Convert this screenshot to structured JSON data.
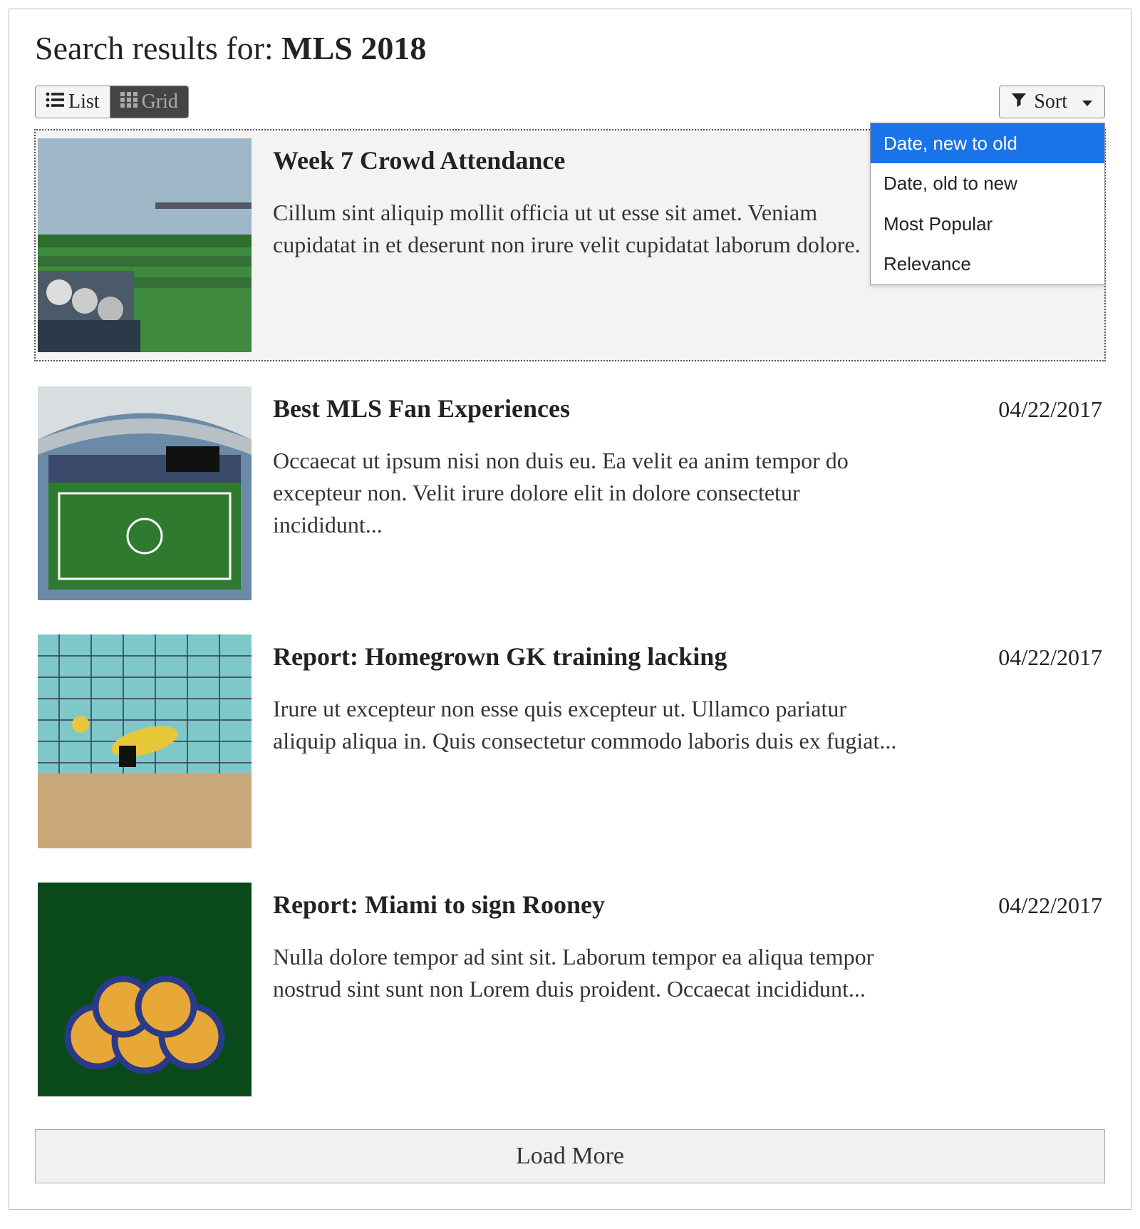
{
  "heading_prefix": "Search results for: ",
  "query": "MLS 2018",
  "view_toggle": {
    "list_label": "List",
    "grid_label": "Grid",
    "active": "list"
  },
  "sort": {
    "button_label": "Sort",
    "menu_open": true,
    "options": [
      {
        "label": "Date, new to old",
        "selected": true
      },
      {
        "label": "Date, old to new",
        "selected": false
      },
      {
        "label": "Most Popular",
        "selected": false
      },
      {
        "label": "Relevance",
        "selected": false
      }
    ]
  },
  "results": [
    {
      "title": "Week 7 Crowd Attendance",
      "date": "",
      "excerpt": "Cillum sint aliquip mollit officia ut ut esse sit amet. Veniam cupidatat in et deserunt non irure velit cupidatat laborum dolore.",
      "thumb": "spectators-pitch",
      "hovered": true
    },
    {
      "title": "Best MLS Fan Experiences",
      "date": "04/22/2017",
      "excerpt": "Occaecat ut ipsum nisi non duis eu. Ea velit ea anim tempor do excepteur non. Velit irure dolore elit in dolore consectetur incididunt...",
      "thumb": "stadium-wide",
      "hovered": false
    },
    {
      "title": "Report: Homegrown GK training lacking",
      "date": "04/22/2017",
      "excerpt": "Irure ut excepteur non esse quis excepteur ut. Ullamco pariatur aliquip aliqua in. Quis consectetur commodo laboris duis ex fugiat...",
      "thumb": "keeper-dive",
      "hovered": false
    },
    {
      "title": "Report: Miami to sign Rooney",
      "date": "04/22/2017",
      "excerpt": "Nulla dolore tempor ad sint sit. Laborum tempor ea aliqua tempor nostrud sint sunt non Lorem duis proident. Occaecat incididunt...",
      "thumb": "soccer-balls",
      "hovered": false
    }
  ],
  "load_more_label": "Load More"
}
